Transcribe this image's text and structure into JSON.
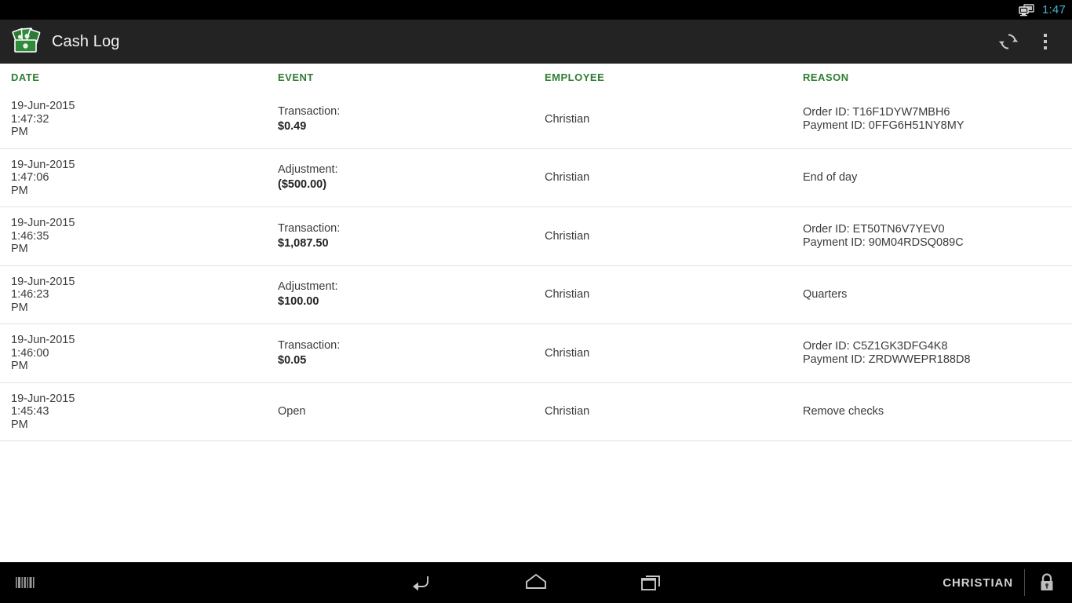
{
  "status_bar": {
    "clock": "1:47",
    "cast_icon": "screen-cast-icon",
    "clock_color": "#44b5d2"
  },
  "action_bar": {
    "logo_icon": "cash-bills-icon",
    "title": "Cash Log",
    "refresh_icon": "refresh-icon",
    "overflow_icon": "overflow-menu-icon",
    "background": "#232323"
  },
  "table": {
    "accent_color": "#2f7d32",
    "headers": {
      "date": "DATE",
      "event": "EVENT",
      "employee": "EMPLOYEE",
      "reason": "REASON"
    },
    "rows": [
      {
        "date": "19-Jun-2015",
        "time": "1:47:32",
        "meridiem": "PM",
        "event_type": "Transaction:",
        "event_amount": "$0.49",
        "employee": "Christian",
        "reason_line1": "Order ID: T16F1DYW7MBH6",
        "reason_line2": "Payment ID: 0FFG6H51NY8MY"
      },
      {
        "date": "19-Jun-2015",
        "time": "1:47:06",
        "meridiem": "PM",
        "event_type": "Adjustment:",
        "event_amount": "($500.00)",
        "employee": "Christian",
        "reason_line1": "End of day",
        "reason_line2": ""
      },
      {
        "date": "19-Jun-2015",
        "time": "1:46:35",
        "meridiem": "PM",
        "event_type": "Transaction:",
        "event_amount": "$1,087.50",
        "employee": "Christian",
        "reason_line1": "Order ID: ET50TN6V7YEV0",
        "reason_line2": "Payment ID: 90M04RDSQ089C"
      },
      {
        "date": "19-Jun-2015",
        "time": "1:46:23",
        "meridiem": "PM",
        "event_type": "Adjustment:",
        "event_amount": "$100.00",
        "employee": "Christian",
        "reason_line1": "Quarters",
        "reason_line2": ""
      },
      {
        "date": "19-Jun-2015",
        "time": "1:46:00",
        "meridiem": "PM",
        "event_type": "Transaction:",
        "event_amount": "$0.05",
        "employee": "Christian",
        "reason_line1": "Order ID: C5Z1GK3DFG4K8",
        "reason_line2": "Payment ID: ZRDWWEPR188D8"
      },
      {
        "date": "19-Jun-2015",
        "time": "1:45:43",
        "meridiem": "PM",
        "event_type": "Open",
        "event_amount": "",
        "employee": "Christian",
        "reason_line1": "Remove checks",
        "reason_line2": ""
      }
    ]
  },
  "nav_bar": {
    "barcode_icon": "barcode-icon",
    "back_icon": "back-icon",
    "home_icon": "home-icon",
    "recents_icon": "recent-apps-icon",
    "user_label": "CHRISTIAN",
    "lock_icon": "lock-icon"
  }
}
